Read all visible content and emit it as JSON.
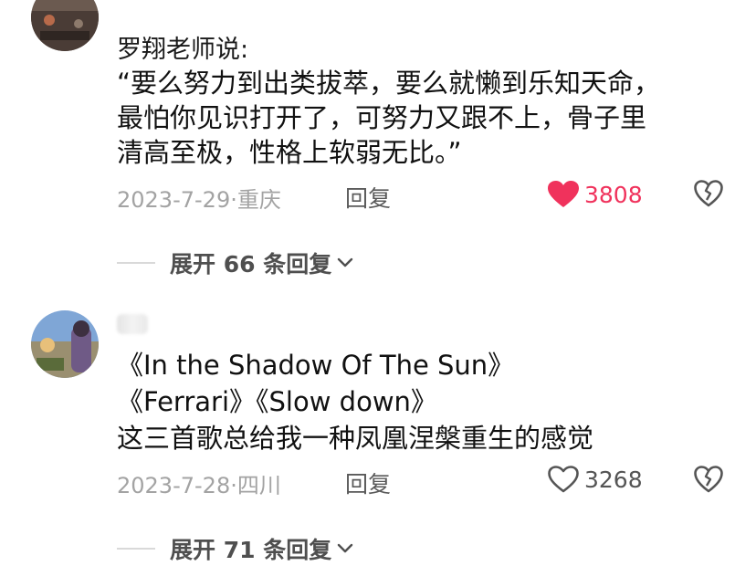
{
  "comments": [
    {
      "nickname": "罗翔老师说:",
      "lines": [
        "“要么努力到出类拔萃，要么就懒到乐知天命，",
        "最怕你见识打开了，可努力又跟不上，骨子里",
        "清高至极，性格上软弱无比。”"
      ],
      "date": "2023-7-29",
      "location": "重庆",
      "reply_label": "回复",
      "like_count": "3808",
      "liked": true,
      "expand_label": "展开 66 条回复"
    },
    {
      "nickname": "",
      "lines": [
        "《In the Shadow Of The Sun》",
        "《Ferrari》《Slow down》",
        "这三首歌总给我一种凤凰涅槃重生的感觉"
      ],
      "date": "2023-7-28",
      "location": "四川",
      "reply_label": "回复",
      "like_count": "3268",
      "liked": false,
      "expand_label": "展开 71 条回复"
    }
  ],
  "colors": {
    "liked": "#f0325c",
    "muted": "#a3a3a3",
    "text": "#111111"
  },
  "icons": {
    "like": "heart-icon",
    "dislike": "broken-heart-icon",
    "expand": "chevron-down-icon"
  }
}
